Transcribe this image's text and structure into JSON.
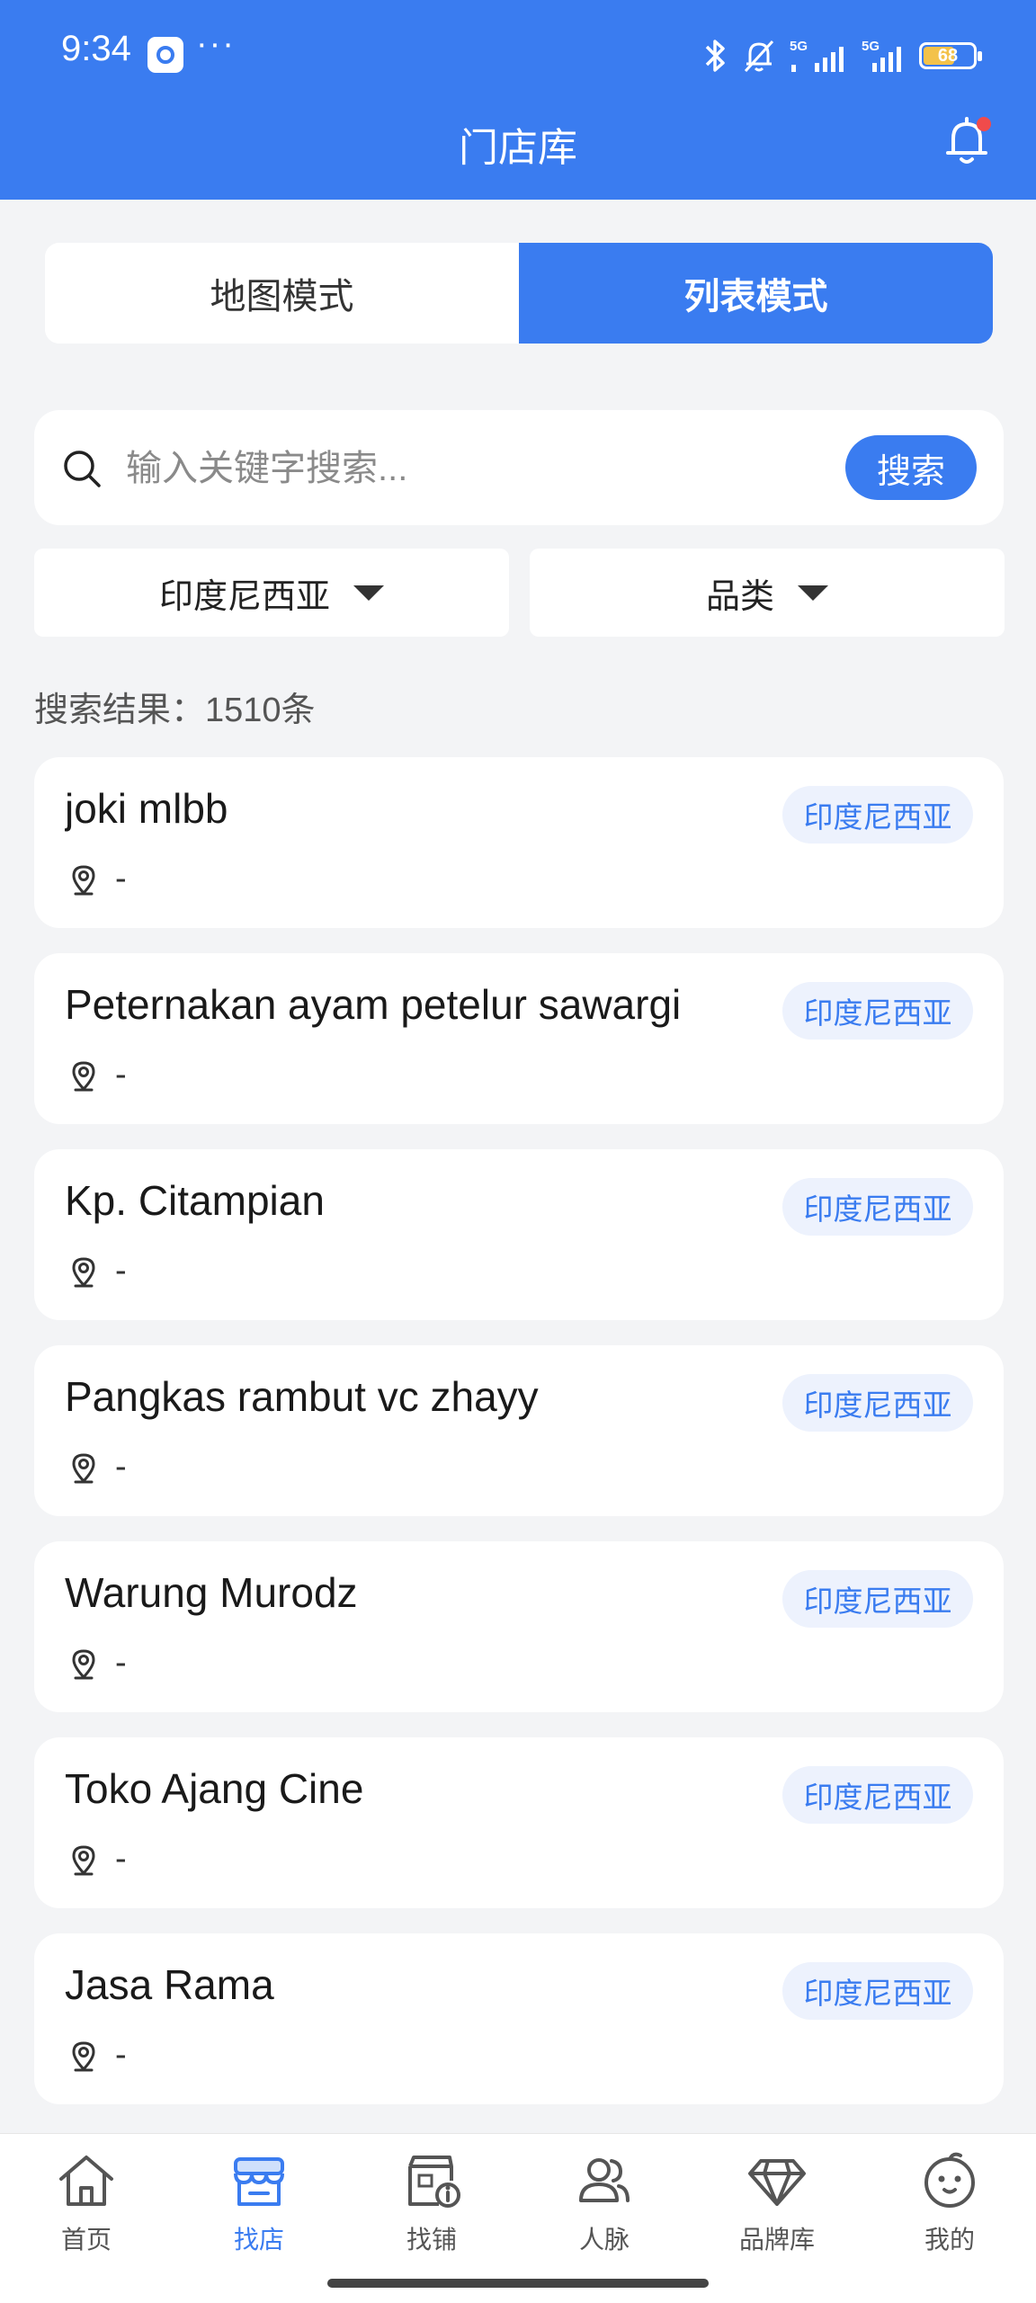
{
  "status_bar": {
    "time": "9:34",
    "more": "···",
    "battery": "68",
    "icons": [
      "app-icon",
      "bluetooth-icon",
      "bell-off-icon",
      "signal-5g-icon",
      "signal-5g-icon",
      "battery-icon"
    ]
  },
  "header": {
    "title": "门店库",
    "notification_icon": "bell-icon"
  },
  "mode_toggle": {
    "map_label": "地图模式",
    "list_label": "列表模式",
    "selected": "列表模式"
  },
  "search": {
    "placeholder": "输入关键字搜索...",
    "value": "",
    "button_label": "搜索"
  },
  "filters": {
    "country": "印度尼西亚",
    "category": "品类"
  },
  "result_count": "搜索结果：1510条",
  "stores": [
    {
      "name": "joki mlbb",
      "tag": "印度尼西亚",
      "location": "-"
    },
    {
      "name": "Peternakan ayam petelur sawargi",
      "tag": "印度尼西亚",
      "location": "-"
    },
    {
      "name": "Kp. Citampian",
      "tag": "印度尼西亚",
      "location": "-"
    },
    {
      "name": "Pangkas rambut vc zhayy",
      "tag": "印度尼西亚",
      "location": "-"
    },
    {
      "name": "Warung Murodz",
      "tag": "印度尼西亚",
      "location": "-"
    },
    {
      "name": "Toko Ajang Cine",
      "tag": "印度尼西亚",
      "location": "-"
    },
    {
      "name": "Jasa Rama",
      "tag": "印度尼西亚",
      "location": "-"
    }
  ],
  "bottom_nav": [
    {
      "label": "首页",
      "icon": "home-icon"
    },
    {
      "label": "找店",
      "icon": "store-icon",
      "active": true
    },
    {
      "label": "找铺",
      "icon": "shop-info-icon"
    },
    {
      "label": "人脉",
      "icon": "people-icon"
    },
    {
      "label": "品牌库",
      "icon": "diamond-icon"
    },
    {
      "label": "我的",
      "icon": "profile-face-icon"
    }
  ],
  "colors": {
    "accent": "#3a7cf0",
    "tag_bg": "#edf2fd",
    "background": "#f3f4f6",
    "badge": "#f04b4b"
  }
}
